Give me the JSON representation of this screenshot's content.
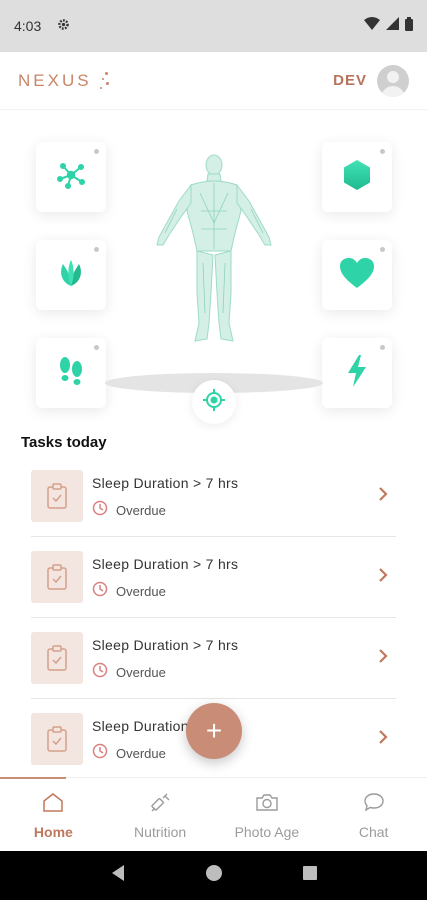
{
  "status_bar": {
    "time": "4:03",
    "icons": [
      "gear-icon",
      "wifi-icon",
      "signal-icon",
      "battery-icon"
    ]
  },
  "app_bar": {
    "logo": "NEXUS",
    "user_name": "DEV"
  },
  "body_tiles": {
    "left": [
      "molecule-icon",
      "leaves-icon",
      "footprints-icon"
    ],
    "right": [
      "hexagon-icon",
      "heart-icon",
      "lightning-icon"
    ],
    "accent_color": "#2ed3a8"
  },
  "tasks": {
    "title": "Tasks today",
    "items": [
      {
        "title": "Sleep Duration > 7 hrs",
        "status": "Overdue"
      },
      {
        "title": "Sleep Duration > 7 hrs",
        "status": "Overdue"
      },
      {
        "title": "Sleep Duration > 7 hrs",
        "status": "Overdue"
      },
      {
        "title": "Sleep Duration > 7 hrs",
        "status": "Overdue"
      }
    ]
  },
  "fab": {
    "label": "+"
  },
  "bottom_nav": {
    "items": [
      {
        "label": "Home",
        "icon": "home-icon",
        "active": true
      },
      {
        "label": "Nutrition",
        "icon": "syringe-icon",
        "active": false
      },
      {
        "label": "Photo Age",
        "icon": "camera-icon",
        "active": false
      },
      {
        "label": "Chat",
        "icon": "chat-icon",
        "active": false
      }
    ]
  },
  "colors": {
    "brand": "#c98c76",
    "accent": "#2ed3a8",
    "overdue": "#d98080"
  }
}
